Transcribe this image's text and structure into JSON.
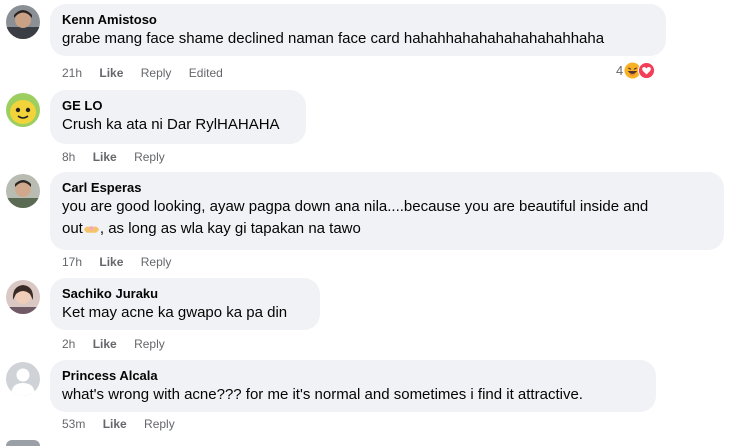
{
  "comments": [
    {
      "author": "Kenn Amistoso",
      "text": "grabe mang face shame declined naman face card hahahhahahahahahahahhaha",
      "time": "21h",
      "like": "Like",
      "reply": "Reply",
      "edited": "Edited",
      "reaction_count": "4",
      "reactions": [
        "laugh-emoji-icon",
        "heart-reaction-icon"
      ],
      "avatar": "avatar-photo-man"
    },
    {
      "author": "GE LO",
      "text": "Crush ka ata ni Dar RylHAHAHA",
      "time": "8h",
      "like": "Like",
      "reply": "Reply",
      "avatar": "avatar-yellow-character"
    },
    {
      "author": "Carl Esperas",
      "text_line1": "you are good looking, ayaw pagpa down ana nila....because you are beautiful inside and",
      "text_line2_before": "out",
      "text_line2_emoji": "heart-hands-emoji",
      "text_line2_after": ", as long as wla kay gi tapakan na tawo",
      "time": "17h",
      "like": "Like",
      "reply": "Reply",
      "avatar": "avatar-photo-person"
    },
    {
      "author": "Sachiko Juraku",
      "text": "Ket may acne ka gwapo ka pa din",
      "time": "2h",
      "like": "Like",
      "reply": "Reply",
      "avatar": "avatar-photo-woman"
    },
    {
      "author": "Princess Alcala",
      "text": "what's wrong with acne??? for me it's normal and sometimes i find it attractive.",
      "time": "53m",
      "like": "Like",
      "reply": "Reply",
      "avatar": "default-avatar-icon"
    }
  ],
  "colors": {
    "bubble": "#f0f2f5",
    "secondary_text": "#65676b",
    "primary_text": "#050505",
    "heart": "#f33e58",
    "laugh": "#f7b125"
  }
}
